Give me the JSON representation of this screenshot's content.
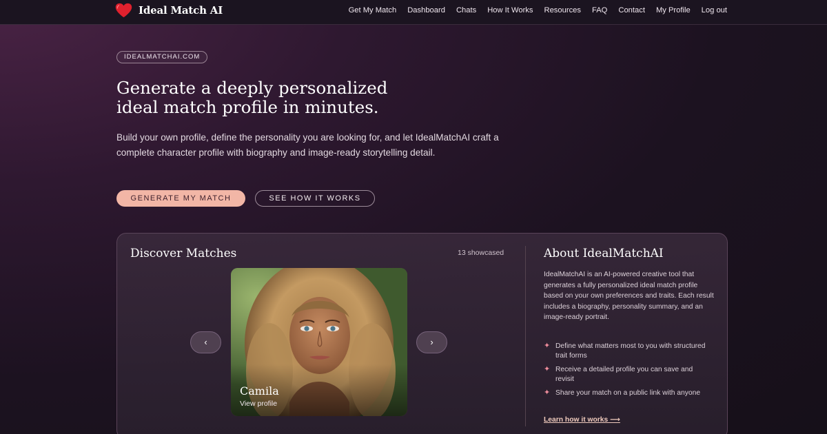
{
  "nav": {
    "brand": "Ideal Match AI",
    "links": [
      "Get My Match",
      "Dashboard",
      "Chats",
      "How It Works",
      "Resources",
      "FAQ",
      "Contact",
      "My Profile",
      "Log out"
    ]
  },
  "hero": {
    "pill": "IDEALMATCHAI.COM",
    "title_line1": "Generate a deeply personalized",
    "title_line2": "ideal match profile in minutes.",
    "subtitle": "Build your own profile, define the personality you are looking for, and let IdealMatchAI craft a complete character profile with biography and image-ready storytelling detail.",
    "primary_button": "GENERATE MY MATCH",
    "secondary_button": "SEE HOW IT WORKS"
  },
  "discover": {
    "title": "Discover Matches",
    "count": "13 showcased",
    "prev_icon": "‹",
    "next_icon": "›",
    "profile_name": "Camila",
    "profile_link": "View profile"
  },
  "about": {
    "title": "About IdealMatchAI",
    "text": "IdealMatchAI is an AI-powered creative tool that generates a fully personalized ideal match profile based on your own preferences and traits. Each result includes a biography, personality summary, and an image-ready portrait.",
    "features": [
      "Define what matters most to you with structured trait forms",
      "Receive a detailed profile you can save and revisit",
      "Share your match on a public link with anyone"
    ],
    "learn_link": "Learn how it works ⟶"
  },
  "colors": {
    "accent": "#f2b6a6",
    "heart": "#e0212e",
    "sparkle": "#ef8d9c"
  },
  "icons": {
    "brand": "heart-icon",
    "feature": "sparkle-icon",
    "prev": "chevron-left-icon",
    "next": "chevron-right-icon"
  }
}
